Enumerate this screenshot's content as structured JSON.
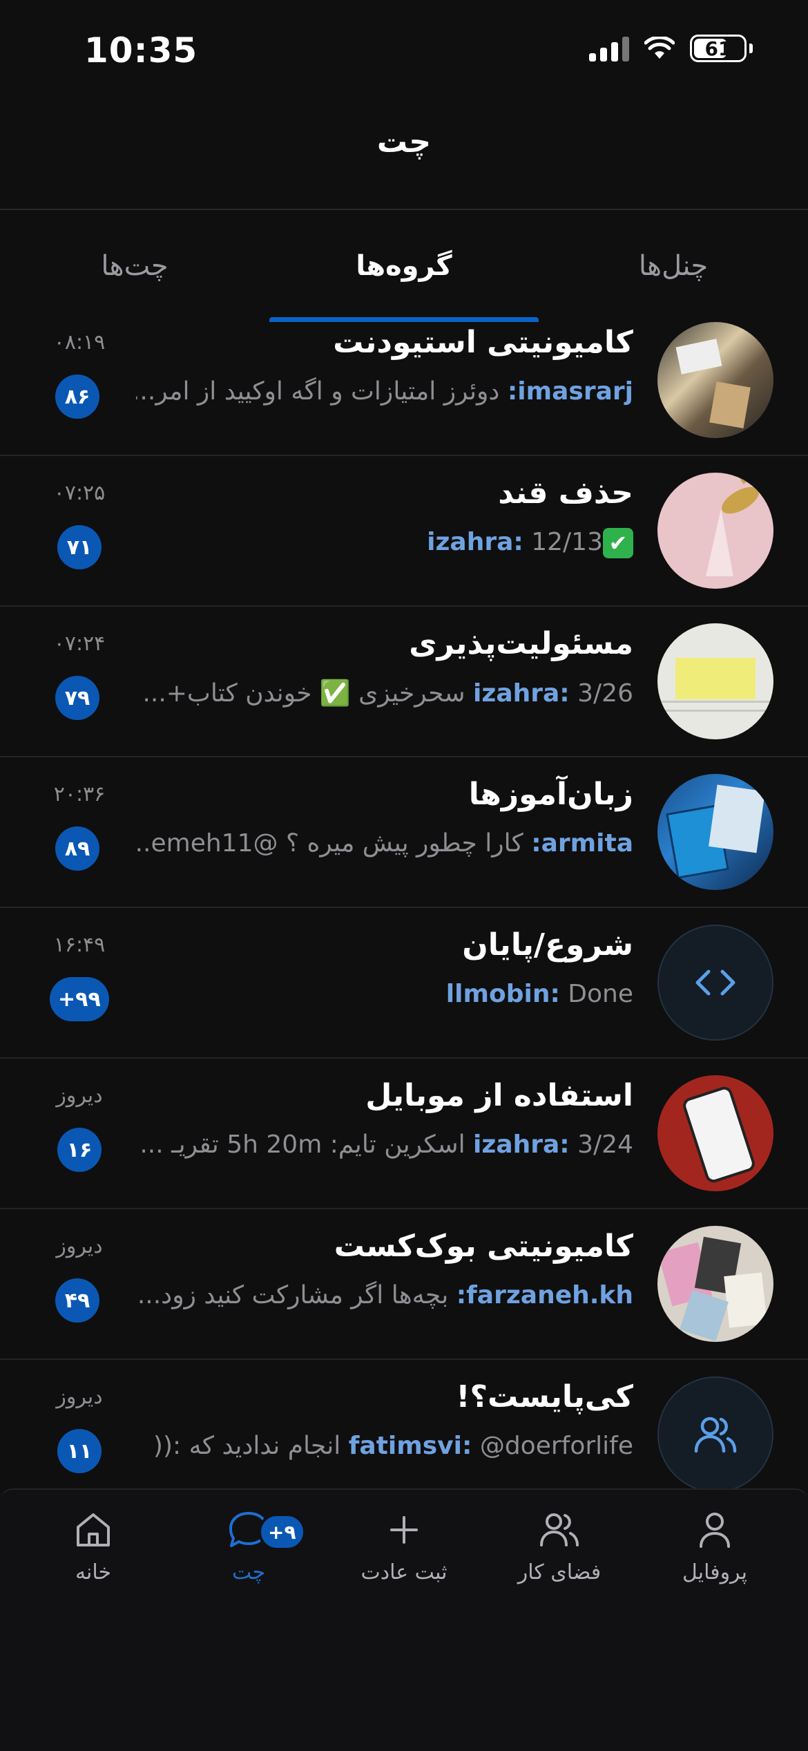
{
  "status_bar": {
    "time": "10:35",
    "battery": "61"
  },
  "header": {
    "title": "چت"
  },
  "tabs": [
    {
      "label": "چنل‌ها",
      "active": false
    },
    {
      "label": "گروه‌ها",
      "active": true
    },
    {
      "label": "چت‌ها",
      "active": false
    }
  ],
  "chats": [
    {
      "title": "کامیونیتی استیودنت",
      "author": "imasrarj:",
      "message": " دوئرز امتیازات و اگه اوکیید از امر...",
      "time": "۰۸:۱۹",
      "unread": "۸۶"
    },
    {
      "title": "حذف قند",
      "author": "izahra:",
      "message": " 12/13",
      "check": "✔",
      "time": "۰۷:۲۵",
      "unread": "۷۱"
    },
    {
      "title": "مسئولیت‌پذیری",
      "author": "izahra:",
      "message": " 3/26 سحرخیزی ✅ خوندن کتاب+...",
      "time": "۰۷:۲۴",
      "unread": "۷۹"
    },
    {
      "title": "زبان‌آموزها",
      "author": "armita:",
      "message": " کارا چطور پیش میره ؟ @emeh11...",
      "time": "۲۰:۳۶",
      "unread": "۸۹"
    },
    {
      "title": "شروع/پایان",
      "author": "llmobin:",
      "message": " Done",
      "time": "۱۶:۴۹",
      "unread": "+۹۹"
    },
    {
      "title": "استفاده از موبایل",
      "author": "izahra:",
      "message": " 3/24 اسکرین تایم: 5h 20m تقریـ ...",
      "time": "دیروز",
      "unread": "۱۶"
    },
    {
      "title": "کامیونیتی بوک‌کست",
      "author": "farzaneh.kh:",
      "message": " بچه‌ها اگر مشارکت کنید زود...",
      "time": "دیروز",
      "unread": "۴۹"
    },
    {
      "title": "کی‌پایست؟!",
      "author": "fatimsvi:",
      "message": " @doerforlife انجام ندادید که :((",
      "time": "دیروز",
      "unread": "۱۱"
    }
  ],
  "tabbar": {
    "home": "خانه",
    "chat": "چت",
    "chat_badge": "+۹",
    "add_habit": "ثبت عادت",
    "workspace": "فضای کار",
    "profile": "پروفایل"
  },
  "colors": {
    "accent": "#0a58b4",
    "author": "#6fa2e0",
    "background": "#0f0f10"
  }
}
